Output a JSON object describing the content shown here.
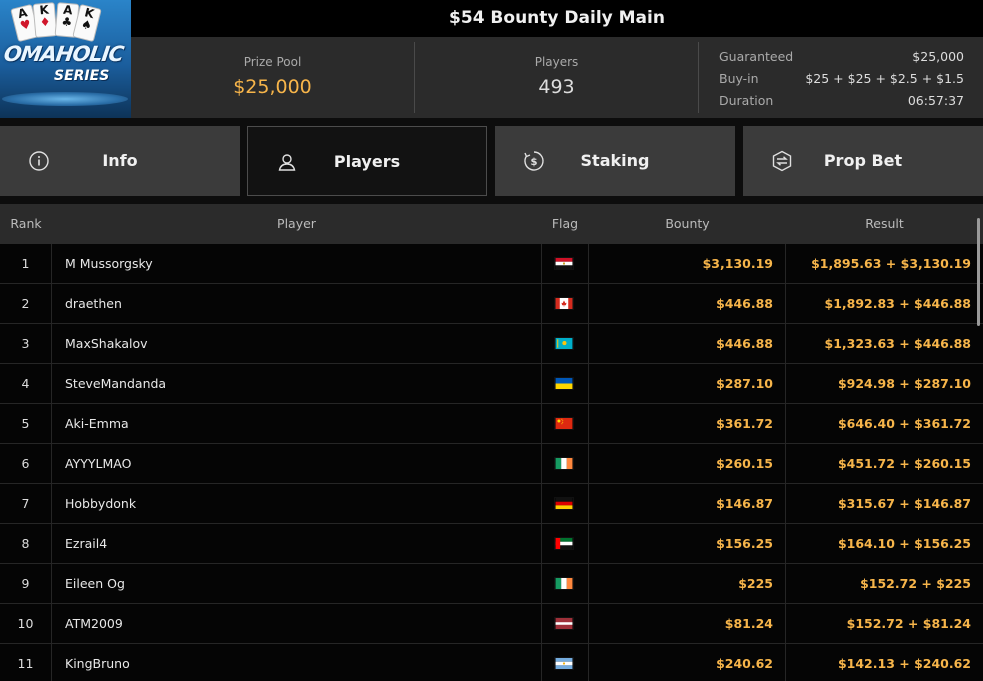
{
  "logo": {
    "cards": [
      "A",
      "K",
      "A",
      "K"
    ],
    "brand": "OMAHOLIC",
    "series": "SERIES"
  },
  "tournament": {
    "title": "$54 Bounty Daily Main",
    "prize_pool_label": "Prize Pool",
    "prize_pool": "$25,000",
    "players_label": "Players",
    "players": "493",
    "guaranteed_label": "Guaranteed",
    "guaranteed": "$25,000",
    "buyin_label": "Buy-in",
    "buyin": "$25 + $25 + $2.5 + $1.5",
    "duration_label": "Duration",
    "duration": "06:57:37"
  },
  "tabs": [
    {
      "label": "Info",
      "icon": "info-icon",
      "active": false
    },
    {
      "label": "Players",
      "icon": "user-icon",
      "active": true
    },
    {
      "label": "Staking",
      "icon": "dollar-coin-icon",
      "active": false
    },
    {
      "label": "Prop Bet",
      "icon": "prop-bet-icon",
      "active": false
    }
  ],
  "table": {
    "headers": {
      "rank": "Rank",
      "player": "Player",
      "flag": "Flag",
      "bounty": "Bounty",
      "result": "Result"
    },
    "rows": [
      {
        "rank": "1",
        "player": "M Mussorgsky",
        "flag": "egypt-flag",
        "bounty": "$3,130.19",
        "result": "$1,895.63 + $3,130.19"
      },
      {
        "rank": "2",
        "player": "draethen",
        "flag": "canada-flag",
        "bounty": "$446.88",
        "result": "$1,892.83 + $446.88"
      },
      {
        "rank": "3",
        "player": "MaxShakalov",
        "flag": "kazakhstan-flag",
        "bounty": "$446.88",
        "result": "$1,323.63 + $446.88"
      },
      {
        "rank": "4",
        "player": "SteveMandanda",
        "flag": "ukraine-flag",
        "bounty": "$287.10",
        "result": "$924.98 + $287.10"
      },
      {
        "rank": "5",
        "player": "Aki-Emma",
        "flag": "china-flag",
        "bounty": "$361.72",
        "result": "$646.40 + $361.72"
      },
      {
        "rank": "6",
        "player": "AYYYLMAO",
        "flag": "ireland-flag",
        "bounty": "$260.15",
        "result": "$451.72 + $260.15"
      },
      {
        "rank": "7",
        "player": "Hobbydonk",
        "flag": "germany-flag",
        "bounty": "$146.87",
        "result": "$315.67 + $146.87"
      },
      {
        "rank": "8",
        "player": "Ezrail4",
        "flag": "uae-flag",
        "bounty": "$156.25",
        "result": "$164.10 + $156.25"
      },
      {
        "rank": "9",
        "player": "Eileen Og",
        "flag": "ireland-flag",
        "bounty": "$225",
        "result": "$152.72 + $225"
      },
      {
        "rank": "10",
        "player": "ATM2009",
        "flag": "latvia-flag",
        "bounty": "$81.24",
        "result": "$152.72 + $81.24"
      },
      {
        "rank": "11",
        "player": "KingBruno",
        "flag": "argentina-flag",
        "bounty": "$240.62",
        "result": "$142.13 + $240.62"
      }
    ]
  },
  "colors": {
    "accent": "#f7b54a",
    "panel": "#2b2b2b",
    "tab": "#3b3b3b"
  }
}
